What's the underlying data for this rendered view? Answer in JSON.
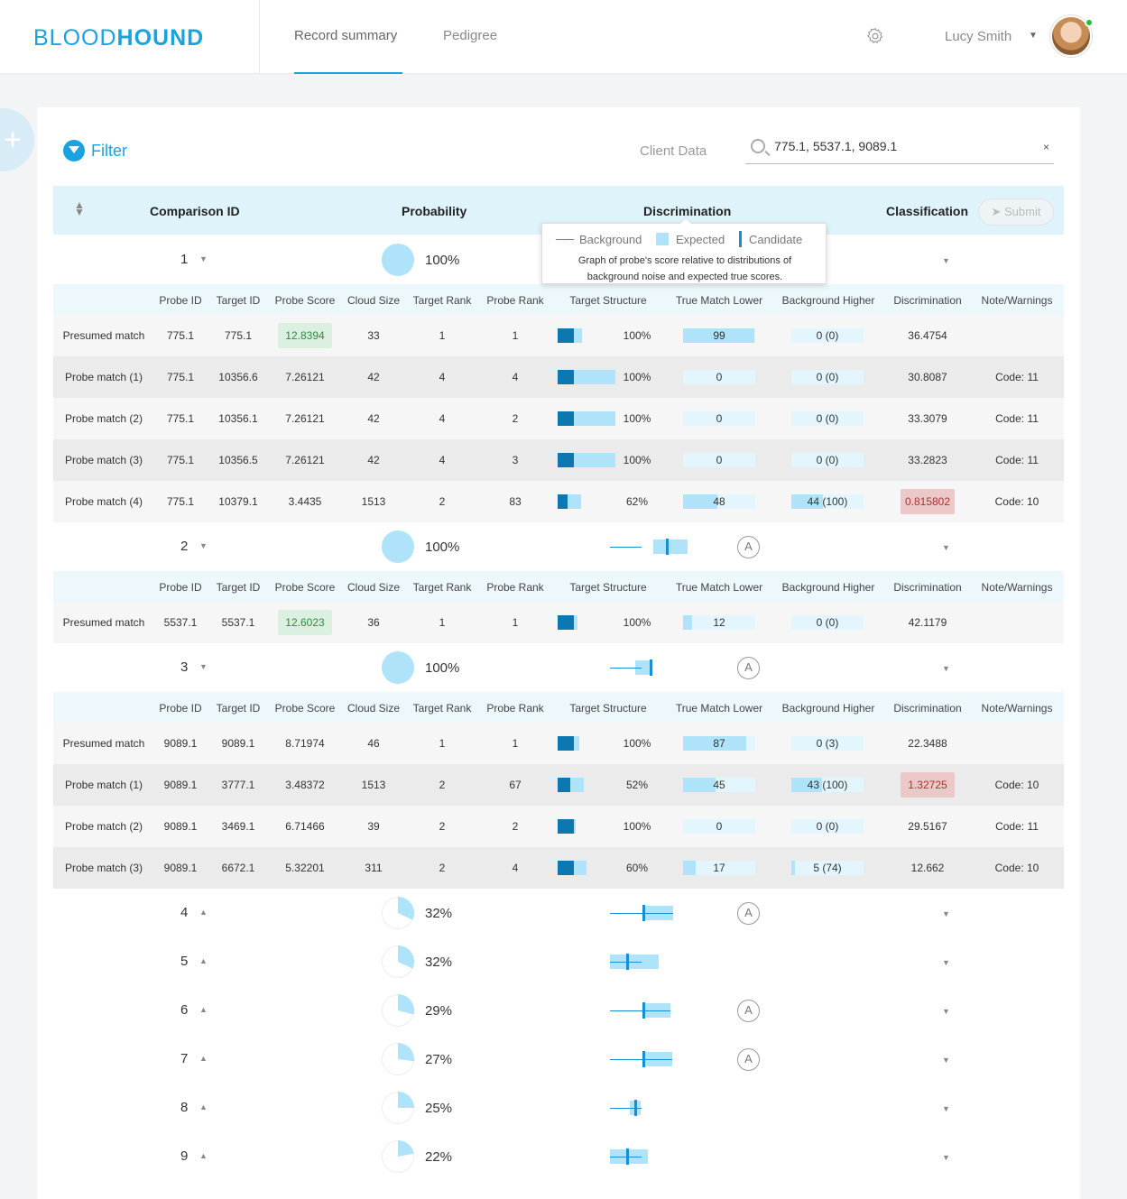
{
  "app": {
    "logo_light": "BLOOD",
    "logo_bold": "HOUND"
  },
  "nav": {
    "tabs": [
      {
        "label": "Record summary",
        "active": true
      },
      {
        "label": "Pedigree",
        "active": false
      }
    ]
  },
  "user": {
    "name": "Lucy Smith",
    "status": "online"
  },
  "icons": {
    "gear": "gear-icon",
    "search": "search-icon",
    "filter": "filter-icon",
    "clear": "close-icon",
    "add": "plus-icon"
  },
  "colors": {
    "accent": "#1aa3e0",
    "dark_bar": "#0d77b0",
    "light_bar": "#aee3f9",
    "good": "#2f8a3f",
    "bad": "#a33333"
  },
  "filter": {
    "label": "Filter",
    "client_label": "Client Data",
    "search_value": "775.1, 5537.1, 9089.1",
    "clear": "×"
  },
  "table": {
    "headers": {
      "comparison": "Comparison ID",
      "probability": "Probability",
      "discrimination": "Discrimination",
      "classification": "Classification",
      "submit": "Submit"
    },
    "sub_headers": [
      "Probe ID",
      "Target ID",
      "Probe Score",
      "Cloud Size",
      "Target Rank",
      "Probe Rank",
      "Target Structure",
      "True Match Lower",
      "Background Higher",
      "Discrimination",
      "Note/Warnings"
    ]
  },
  "tooltip": {
    "background": "Background",
    "expected": "Expected",
    "candidate": "Candidate",
    "desc1": "Graph of probe's score relative to distributions of",
    "desc2": "background noise and expected true scores."
  },
  "comparisons": [
    {
      "id": "1",
      "prob": "100%",
      "prob_value": 1.0,
      "expanded": true,
      "badge": "",
      "details": [
        {
          "label": "Presumed match",
          "probe": "775.1",
          "target": "775.1",
          "score": "12.8394",
          "score_good": true,
          "cloud": "33",
          "trank": "1",
          "prank": "1",
          "ts_dark": 0.28,
          "ts_light": 0.42,
          "ts_pct": "100%",
          "tml": "99",
          "tml_v": 0.99,
          "bgh": "0 (0)",
          "bgh_v": 0.0,
          "disc": "36.4754",
          "disc_bad": false,
          "note": ""
        },
        {
          "label": "Probe match (1)",
          "probe": "775.1",
          "target": "10356.6",
          "score": "7.26121",
          "score_good": false,
          "cloud": "42",
          "trank": "4",
          "prank": "4",
          "ts_dark": 0.28,
          "ts_light": 1.0,
          "ts_pct": "100%",
          "tml": "0",
          "tml_v": 0.0,
          "bgh": "0 (0)",
          "bgh_v": 0.0,
          "disc": "30.8087",
          "disc_bad": false,
          "note": "Code: 11"
        },
        {
          "label": "Probe match (2)",
          "probe": "775.1",
          "target": "10356.1",
          "score": "7.26121",
          "score_good": false,
          "cloud": "42",
          "trank": "4",
          "prank": "2",
          "ts_dark": 0.28,
          "ts_light": 1.0,
          "ts_pct": "100%",
          "tml": "0",
          "tml_v": 0.0,
          "bgh": "0 (0)",
          "bgh_v": 0.0,
          "disc": "33.3079",
          "disc_bad": false,
          "note": "Code: 11"
        },
        {
          "label": "Probe match (3)",
          "probe": "775.1",
          "target": "10356.5",
          "score": "7.26121",
          "score_good": false,
          "cloud": "42",
          "trank": "4",
          "prank": "3",
          "ts_dark": 0.28,
          "ts_light": 1.0,
          "ts_pct": "100%",
          "tml": "0",
          "tml_v": 0.0,
          "bgh": "0 (0)",
          "bgh_v": 0.0,
          "disc": "33.2823",
          "disc_bad": false,
          "note": "Code: 11"
        },
        {
          "label": "Probe match (4)",
          "probe": "775.1",
          "target": "10379.1",
          "score": "3.4435",
          "score_good": false,
          "cloud": "1513",
          "trank": "2",
          "prank": "83",
          "ts_dark": 0.17,
          "ts_light": 0.4,
          "ts_pct": "62%",
          "tml": "48",
          "tml_v": 0.48,
          "bgh": "44 (100)",
          "bgh_v": 0.44,
          "disc": "0.815802",
          "disc_bad": true,
          "note": "Code: 10"
        }
      ]
    },
    {
      "id": "2",
      "prob": "100%",
      "prob_value": 1.0,
      "expanded": true,
      "badge": "A",
      "details": [
        {
          "label": "Presumed match",
          "probe": "5537.1",
          "target": "5537.1",
          "score": "12.6023",
          "score_good": true,
          "cloud": "36",
          "trank": "1",
          "prank": "1",
          "ts_dark": 0.28,
          "ts_light": 0.35,
          "ts_pct": "100%",
          "tml": "12",
          "tml_v": 0.12,
          "bgh": "0 (0)",
          "bgh_v": 0.0,
          "disc": "42.1179",
          "disc_bad": false,
          "note": ""
        }
      ]
    },
    {
      "id": "3",
      "prob": "100%",
      "prob_value": 1.0,
      "expanded": true,
      "badge": "A",
      "details": [
        {
          "label": "Presumed match",
          "probe": "9089.1",
          "target": "9089.1",
          "score": "8.71974",
          "score_good": false,
          "cloud": "46",
          "trank": "1",
          "prank": "1",
          "ts_dark": 0.28,
          "ts_light": 0.38,
          "ts_pct": "100%",
          "tml": "87",
          "tml_v": 0.87,
          "bgh": "0 (3)",
          "bgh_v": 0.0,
          "disc": "22.3488",
          "disc_bad": false,
          "note": ""
        },
        {
          "label": "Probe match (1)",
          "probe": "9089.1",
          "target": "3777.1",
          "score": "3.48372",
          "score_good": false,
          "cloud": "1513",
          "trank": "2",
          "prank": "67",
          "ts_dark": 0.22,
          "ts_light": 0.45,
          "ts_pct": "52%",
          "tml": "45",
          "tml_v": 0.45,
          "bgh": "43 (100)",
          "bgh_v": 0.43,
          "disc": "1.32725",
          "disc_bad": true,
          "note": "Code: 10"
        },
        {
          "label": "Probe match (2)",
          "probe": "9089.1",
          "target": "3469.1",
          "score": "6.71466",
          "score_good": false,
          "cloud": "39",
          "trank": "2",
          "prank": "2",
          "ts_dark": 0.28,
          "ts_light": 0.32,
          "ts_pct": "100%",
          "tml": "0",
          "tml_v": 0.0,
          "bgh": "0 (0)",
          "bgh_v": 0.0,
          "disc": "29.5167",
          "disc_bad": false,
          "note": "Code: 11"
        },
        {
          "label": "Probe match (3)",
          "probe": "9089.1",
          "target": "6672.1",
          "score": "5.32201",
          "score_good": false,
          "cloud": "311",
          "trank": "2",
          "prank": "4",
          "ts_dark": 0.28,
          "ts_light": 0.5,
          "ts_pct": "60%",
          "tml": "17",
          "tml_v": 0.17,
          "bgh": "5 (74)",
          "bgh_v": 0.05,
          "disc": "12.662",
          "disc_bad": false,
          "note": "Code: 10"
        }
      ]
    },
    {
      "id": "4",
      "prob": "32%",
      "prob_value": 0.32,
      "expanded": false,
      "badge": "A",
      "details": []
    },
    {
      "id": "5",
      "prob": "32%",
      "prob_value": 0.32,
      "expanded": false,
      "badge": "",
      "details": []
    },
    {
      "id": "6",
      "prob": "29%",
      "prob_value": 0.29,
      "expanded": false,
      "badge": "A",
      "details": []
    },
    {
      "id": "7",
      "prob": "27%",
      "prob_value": 0.27,
      "expanded": false,
      "badge": "A",
      "details": []
    },
    {
      "id": "8",
      "prob": "25%",
      "prob_value": 0.25,
      "expanded": false,
      "badge": "",
      "details": []
    },
    {
      "id": "9",
      "prob": "22%",
      "prob_value": 0.22,
      "expanded": false,
      "badge": "",
      "details": []
    }
  ]
}
